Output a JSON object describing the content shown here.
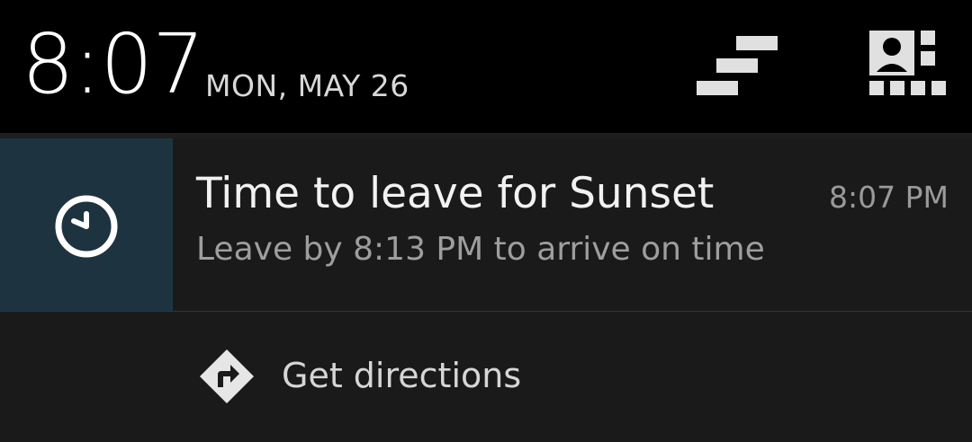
{
  "status_header": {
    "time": "8:07",
    "date": "MON, MAY 26",
    "settings_icon": "quick-settings-icon",
    "user_icon": "user-quick-settings-icon"
  },
  "notification": {
    "app_icon": "clock-icon",
    "icon_tile_color": "#1e3340",
    "title": "Time to leave for Sunset",
    "time": "8:07 PM",
    "text": "Leave by 8:13 PM to arrive on time"
  },
  "action": {
    "icon": "directions-icon",
    "label": "Get directions"
  }
}
